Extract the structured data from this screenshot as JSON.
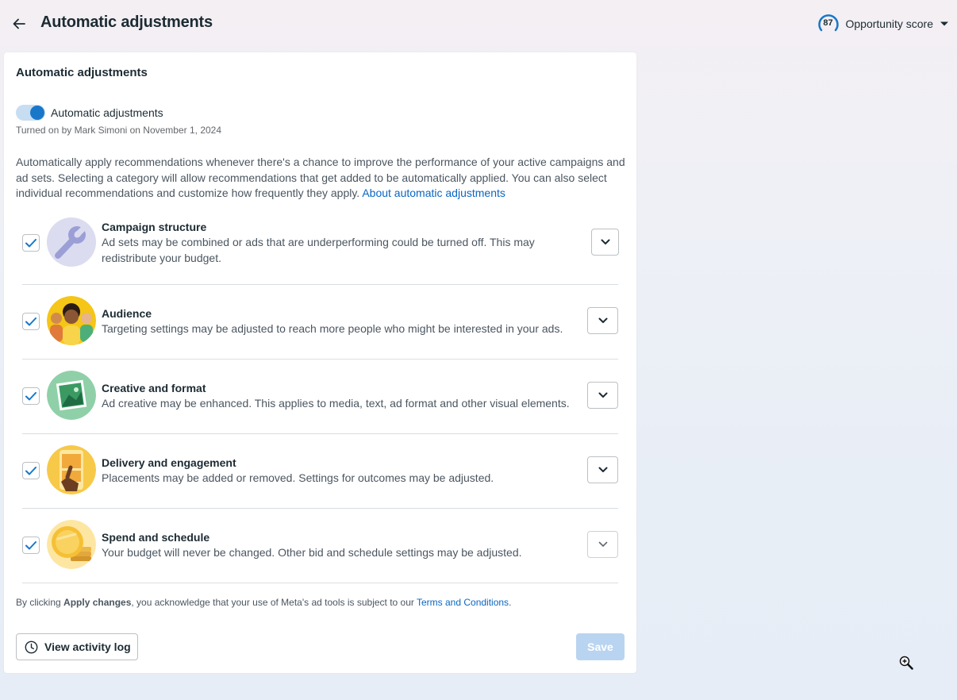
{
  "header": {
    "title": "Automatic adjustments",
    "opportunity": {
      "score": "87",
      "label": "Opportunity score"
    }
  },
  "card": {
    "title": "Automatic adjustments",
    "toggle": {
      "label": "Automatic adjustments",
      "on": true,
      "subtext": "Turned on by Mark Simoni on November 1, 2024"
    },
    "description": "Automatically apply recommendations whenever there's a chance to improve the performance of your active campaigns and ad sets. Selecting a category will allow recommendations that get added to be automatically applied. You can also select individual recommendations and customize how frequently they apply.",
    "description_link": "About automatic adjustments",
    "categories": [
      {
        "title": "Campaign structure",
        "desc": "Ad sets may be combined or ads that are underperforming could be turned off. This may redistribute your budget.",
        "checked": true,
        "icon": "wrench-icon"
      },
      {
        "title": "Audience",
        "desc": "Targeting settings may be adjusted to reach more people who might be interested in your ads.",
        "checked": true,
        "icon": "people-icon"
      },
      {
        "title": "Creative and format",
        "desc": "Ad creative may be enhanced. This applies to media, text, ad format and other visual elements.",
        "checked": true,
        "icon": "image-icon"
      },
      {
        "title": "Delivery and engagement",
        "desc": "Placements may be added or removed. Settings for outcomes may be adjusted.",
        "checked": true,
        "icon": "hand-tap-icon"
      },
      {
        "title": "Spend and schedule",
        "desc": "Your budget will never be changed. Other bid and schedule settings may be adjusted.",
        "checked": true,
        "icon": "coin-icon"
      }
    ],
    "legal": {
      "prefix": "By clicking ",
      "bold": "Apply changes",
      "middle": ", you acknowledge that your use of Meta's ad tools is subject to our ",
      "link": "Terms and Conditions",
      "suffix": "."
    },
    "activity_button": "View activity log",
    "save_button": "Save"
  },
  "colors": {
    "accent": "#1877c9",
    "link": "#0a66c2",
    "save_disabled": "#b9d4f0"
  }
}
